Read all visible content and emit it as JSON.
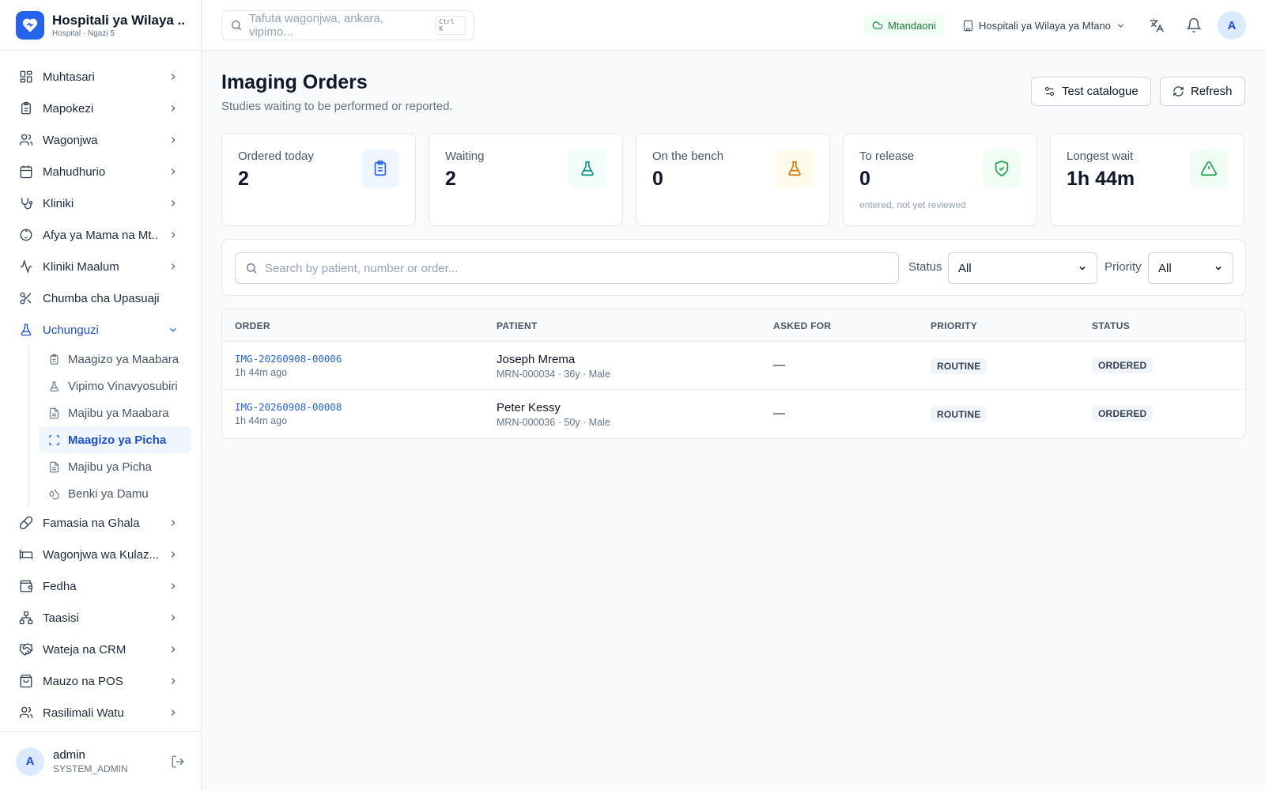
{
  "brand": {
    "title": "Hospitali ya Wilaya ...",
    "subtitle": "Hospital · Ngazi 5"
  },
  "sidebar": {
    "items": [
      {
        "label": "Muhtasari",
        "icon": "dashboard-icon"
      },
      {
        "label": "Mapokezi",
        "icon": "clipboard-icon"
      },
      {
        "label": "Wagonjwa",
        "icon": "users-icon"
      },
      {
        "label": "Mahudhurio",
        "icon": "calendar-icon"
      },
      {
        "label": "Kliniki",
        "icon": "stethoscope-icon"
      },
      {
        "label": "Afya ya Mama na Mt...",
        "icon": "baby-icon"
      },
      {
        "label": "Kliniki Maalum",
        "icon": "activity-icon"
      },
      {
        "label": "Chumba cha Upasuaji",
        "icon": "scissors-icon"
      },
      {
        "label": "Uchunguzi",
        "icon": "flask-icon"
      }
    ],
    "subitems": [
      {
        "label": "Maagizo ya Maabara",
        "icon": "clipboard-icon"
      },
      {
        "label": "Vipimo Vinavyosubiri",
        "icon": "flask-icon"
      },
      {
        "label": "Majibu ya Maabara",
        "icon": "file-icon"
      },
      {
        "label": "Maagizo ya Picha",
        "icon": "scan-icon"
      },
      {
        "label": "Majibu ya Picha",
        "icon": "file-icon"
      },
      {
        "label": "Benki ya Damu",
        "icon": "droplets-icon"
      }
    ],
    "items_after": [
      {
        "label": "Famasia na Ghala",
        "icon": "pill-icon"
      },
      {
        "label": "Wagonjwa wa Kulaz...",
        "icon": "bed-icon"
      },
      {
        "label": "Fedha",
        "icon": "wallet-icon"
      },
      {
        "label": "Taasisi",
        "icon": "network-icon"
      },
      {
        "label": "Wateja na CRM",
        "icon": "handshake-icon"
      },
      {
        "label": "Mauzo na POS",
        "icon": "shopping-bag-icon"
      },
      {
        "label": "Rasilimali Watu",
        "icon": "users-icon"
      }
    ]
  },
  "user": {
    "initial": "A",
    "name": "admin",
    "role": "SYSTEM_ADMIN"
  },
  "topbar": {
    "search_placeholder": "Tafuta wagonjwa, ankara, vipimo...",
    "shortcut": "Ctrl K",
    "status": "Mtandaoni",
    "facility": "Hospitali ya Wilaya ya Mfano",
    "avatar": "A"
  },
  "page": {
    "title": "Imaging Orders",
    "subtitle": "Studies waiting to be performed or reported.",
    "catalogue_btn": "Test catalogue",
    "refresh_btn": "Refresh"
  },
  "stats": [
    {
      "label": "Ordered today",
      "value": "2",
      "sub": "",
      "icon": "clipboard-icon",
      "color": "#2563eb",
      "bg": "#eff6ff"
    },
    {
      "label": "Waiting",
      "value": "2",
      "sub": "",
      "icon": "flask-icon",
      "color": "#0d9488",
      "bg": "#f0fdfa"
    },
    {
      "label": "On the bench",
      "value": "0",
      "sub": "",
      "icon": "flask-icon",
      "color": "#d97706",
      "bg": "#fffbeb"
    },
    {
      "label": "To release",
      "value": "0",
      "sub": "entered, not yet reviewed",
      "icon": "shield-check-icon",
      "color": "#16a34a",
      "bg": "#f0fdf4"
    },
    {
      "label": "Longest wait",
      "value": "1h 44m",
      "sub": "",
      "icon": "alert-triangle-icon",
      "color": "#16a34a",
      "bg": "#f0fdf4"
    }
  ],
  "filters": {
    "search_placeholder": "Search by patient, number or order...",
    "status_label": "Status",
    "status_value": "All",
    "priority_label": "Priority",
    "priority_value": "All"
  },
  "table": {
    "headers": {
      "order": "ORDER",
      "patient": "PATIENT",
      "asked_for": "ASKED FOR",
      "priority": "PRIORITY",
      "status": "STATUS"
    },
    "rows": [
      {
        "order": "IMG-20260908-00006",
        "time": "1h 44m ago",
        "patient": "Joseph Mrema",
        "meta": "MRN-000034 · 36y · Male",
        "asked_for": "—",
        "priority": "ROUTINE",
        "status": "ORDERED"
      },
      {
        "order": "IMG-20260908-00008",
        "time": "1h 44m ago",
        "patient": "Peter Kessy",
        "meta": "MRN-000036 · 50y · Male",
        "asked_for": "—",
        "priority": "ROUTINE",
        "status": "ORDERED"
      }
    ]
  }
}
